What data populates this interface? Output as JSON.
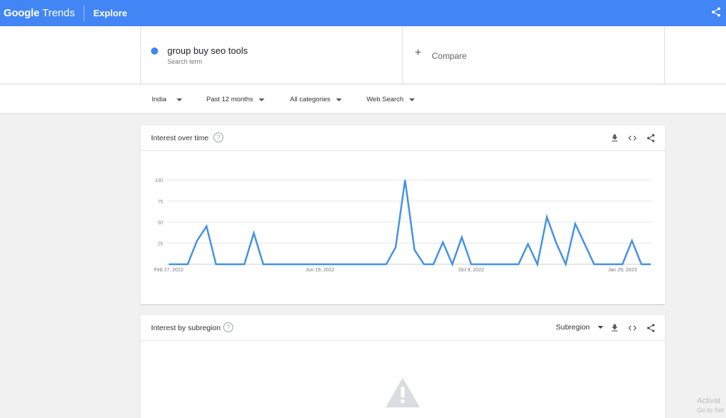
{
  "header": {
    "logo_google": "Google",
    "logo_trends": "Trends",
    "section": "Explore",
    "share_icon": "share-icon"
  },
  "search": {
    "term": "group buy seo tools",
    "term_sub": "Search term",
    "term_color": "#4285f4",
    "compare_label": "Compare",
    "compare_icon": "plus-icon"
  },
  "filters": [
    {
      "label": "India"
    },
    {
      "label": "Past 12 months"
    },
    {
      "label": "All categories"
    },
    {
      "label": "Web Search"
    }
  ],
  "interest_over_time": {
    "title": "Interest over time",
    "help_icon": "help-icon",
    "icons": [
      "download-icon",
      "embed-icon",
      "share-icon"
    ]
  },
  "interest_by_subregion": {
    "title": "Interest by subregion",
    "select_label": "Subregion",
    "icons": [
      "download-icon",
      "embed-icon",
      "share-icon"
    ],
    "warning_icon": "warning-icon"
  },
  "watermark": {
    "line1": "Activat",
    "line2": "Go to Set"
  },
  "chart_data": {
    "type": "line",
    "title": "",
    "xlabel": "",
    "ylabel": "",
    "ylim": [
      0,
      100
    ],
    "yticks": [
      100,
      75,
      50,
      25
    ],
    "xtick_labels": [
      "Feb 27, 2022",
      "Jun 19, 2022",
      "Oct 9, 2022",
      "Jan 29, 2023"
    ],
    "xtick_indices": [
      0,
      16,
      32,
      48
    ],
    "grid": true,
    "color": "#4592e6",
    "series": [
      {
        "name": "group buy seo tools",
        "values": [
          0,
          0,
          0,
          28,
          45,
          0,
          0,
          0,
          0,
          37,
          0,
          0,
          0,
          0,
          0,
          0,
          0,
          0,
          0,
          0,
          0,
          0,
          0,
          0,
          20,
          100,
          17,
          0,
          0,
          26,
          0,
          32,
          0,
          0,
          0,
          0,
          0,
          0,
          24,
          0,
          56,
          25,
          0,
          48,
          24,
          0,
          0,
          0,
          0,
          28,
          0,
          0
        ]
      }
    ]
  }
}
